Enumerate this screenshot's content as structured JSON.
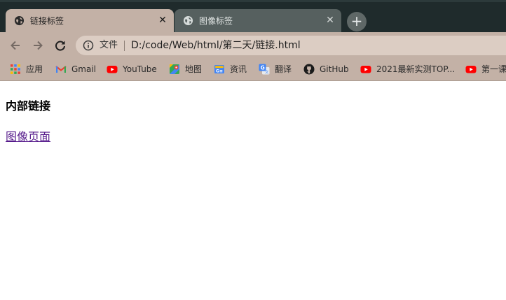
{
  "tabs": [
    {
      "title": "链接标签",
      "active": true
    },
    {
      "title": "图像标签",
      "active": false
    }
  ],
  "tab_close_glyph": "✕",
  "new_tab_glyph": "+",
  "address_bar": {
    "scheme_label": "文件",
    "url": "D:/code/Web/html/第二天/链接.html"
  },
  "bookmarks": [
    {
      "label": "应用",
      "icon": "apps-grid-icon"
    },
    {
      "label": "Gmail",
      "icon": "gmail-icon"
    },
    {
      "label": "YouTube",
      "icon": "youtube-icon"
    },
    {
      "label": "地图",
      "icon": "maps-icon"
    },
    {
      "label": "资讯",
      "icon": "news-icon"
    },
    {
      "label": "翻译",
      "icon": "translate-icon"
    },
    {
      "label": "GitHub",
      "icon": "github-icon"
    },
    {
      "label": "2021最新实测TOP...",
      "icon": "youtube-icon"
    },
    {
      "label": "第一课",
      "icon": "youtube-icon"
    }
  ],
  "page": {
    "heading": "内部链接",
    "link_text": "图像页面"
  },
  "colors": {
    "tab_strip": "#1f2b2c",
    "active_tab": "#c3b1a6",
    "inactive_tab": "#56605f",
    "omnibox": "#dccdc3",
    "visited_link": "#551a8b"
  }
}
